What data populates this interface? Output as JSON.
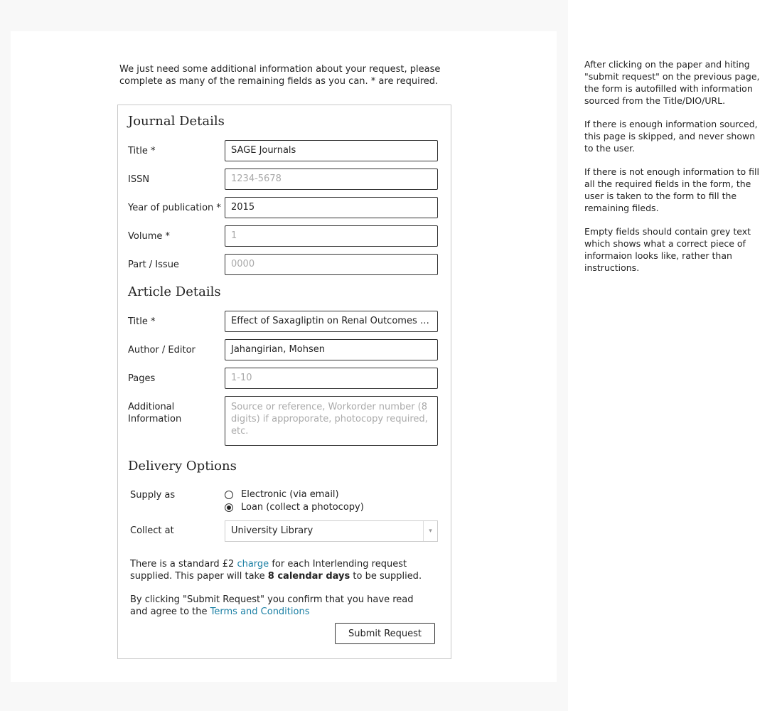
{
  "intro": "We just need some additional information about your request, please complete as many of the remaining fields as you can. * are required.",
  "journal": {
    "heading": "Journal Details",
    "title_label": "Title *",
    "title_value": "SAGE Journals",
    "issn_label": "ISSN",
    "issn_placeholder": "1234-5678",
    "year_label": "Year of publication *",
    "year_value": "2015",
    "volume_label": "Volume *",
    "volume_placeholder": "1",
    "issue_label": "Part / Issue",
    "issue_placeholder": "0000"
  },
  "article": {
    "heading": "Article Details",
    "title_label": "Title *",
    "title_value": "Effect of Saxagliptin on Renal Outcomes in . .",
    "author_label": "Author / Editor",
    "author_value": "Jahangirian, Mohsen",
    "pages_label": "Pages",
    "pages_placeholder": "1-10",
    "additional_label_1": "Additional",
    "additional_label_2": "Information",
    "additional_placeholder": "Source or reference, Workorder number (8 digits) if approporate, photocopy required, etc."
  },
  "delivery": {
    "heading": "Delivery Options",
    "supply_label": "Supply as",
    "options": [
      {
        "label": "Electronic (via email)",
        "checked": false
      },
      {
        "label": "Loan (collect a photocopy)",
        "checked": true
      }
    ],
    "collect_label": "Collect at",
    "collect_value": "University Library",
    "arrow_icon": "▾"
  },
  "charge": {
    "part1": "There is a standard £2 ",
    "link": "charge",
    "part2": " for each Interlending request supplied. This paper will take ",
    "days": "8 calendar days",
    "part3": " to be supplied."
  },
  "terms": {
    "part1": "By clicking \"Submit Request\" you confirm that you have read and agree to the ",
    "link": "Terms and Conditions"
  },
  "submit_label": "Submit Request",
  "notes": [
    "After clicking on the paper and hiting \"submit request\" on the previous page, the form is autofilled with information sourced from the Title/DIO/URL.",
    "If there is enough information sourced, this page is skipped, and never shown to the user.",
    "If there is not enough information to fill all the required fields in the form, the user is taken to the form to fill the remaining fileds.",
    "Empty fields should contain grey text which shows what a correct piece of informaion looks like, rather than instructions."
  ],
  "colors": {
    "link": "#1a7fa4",
    "placeholder": "#aaaaaa"
  }
}
